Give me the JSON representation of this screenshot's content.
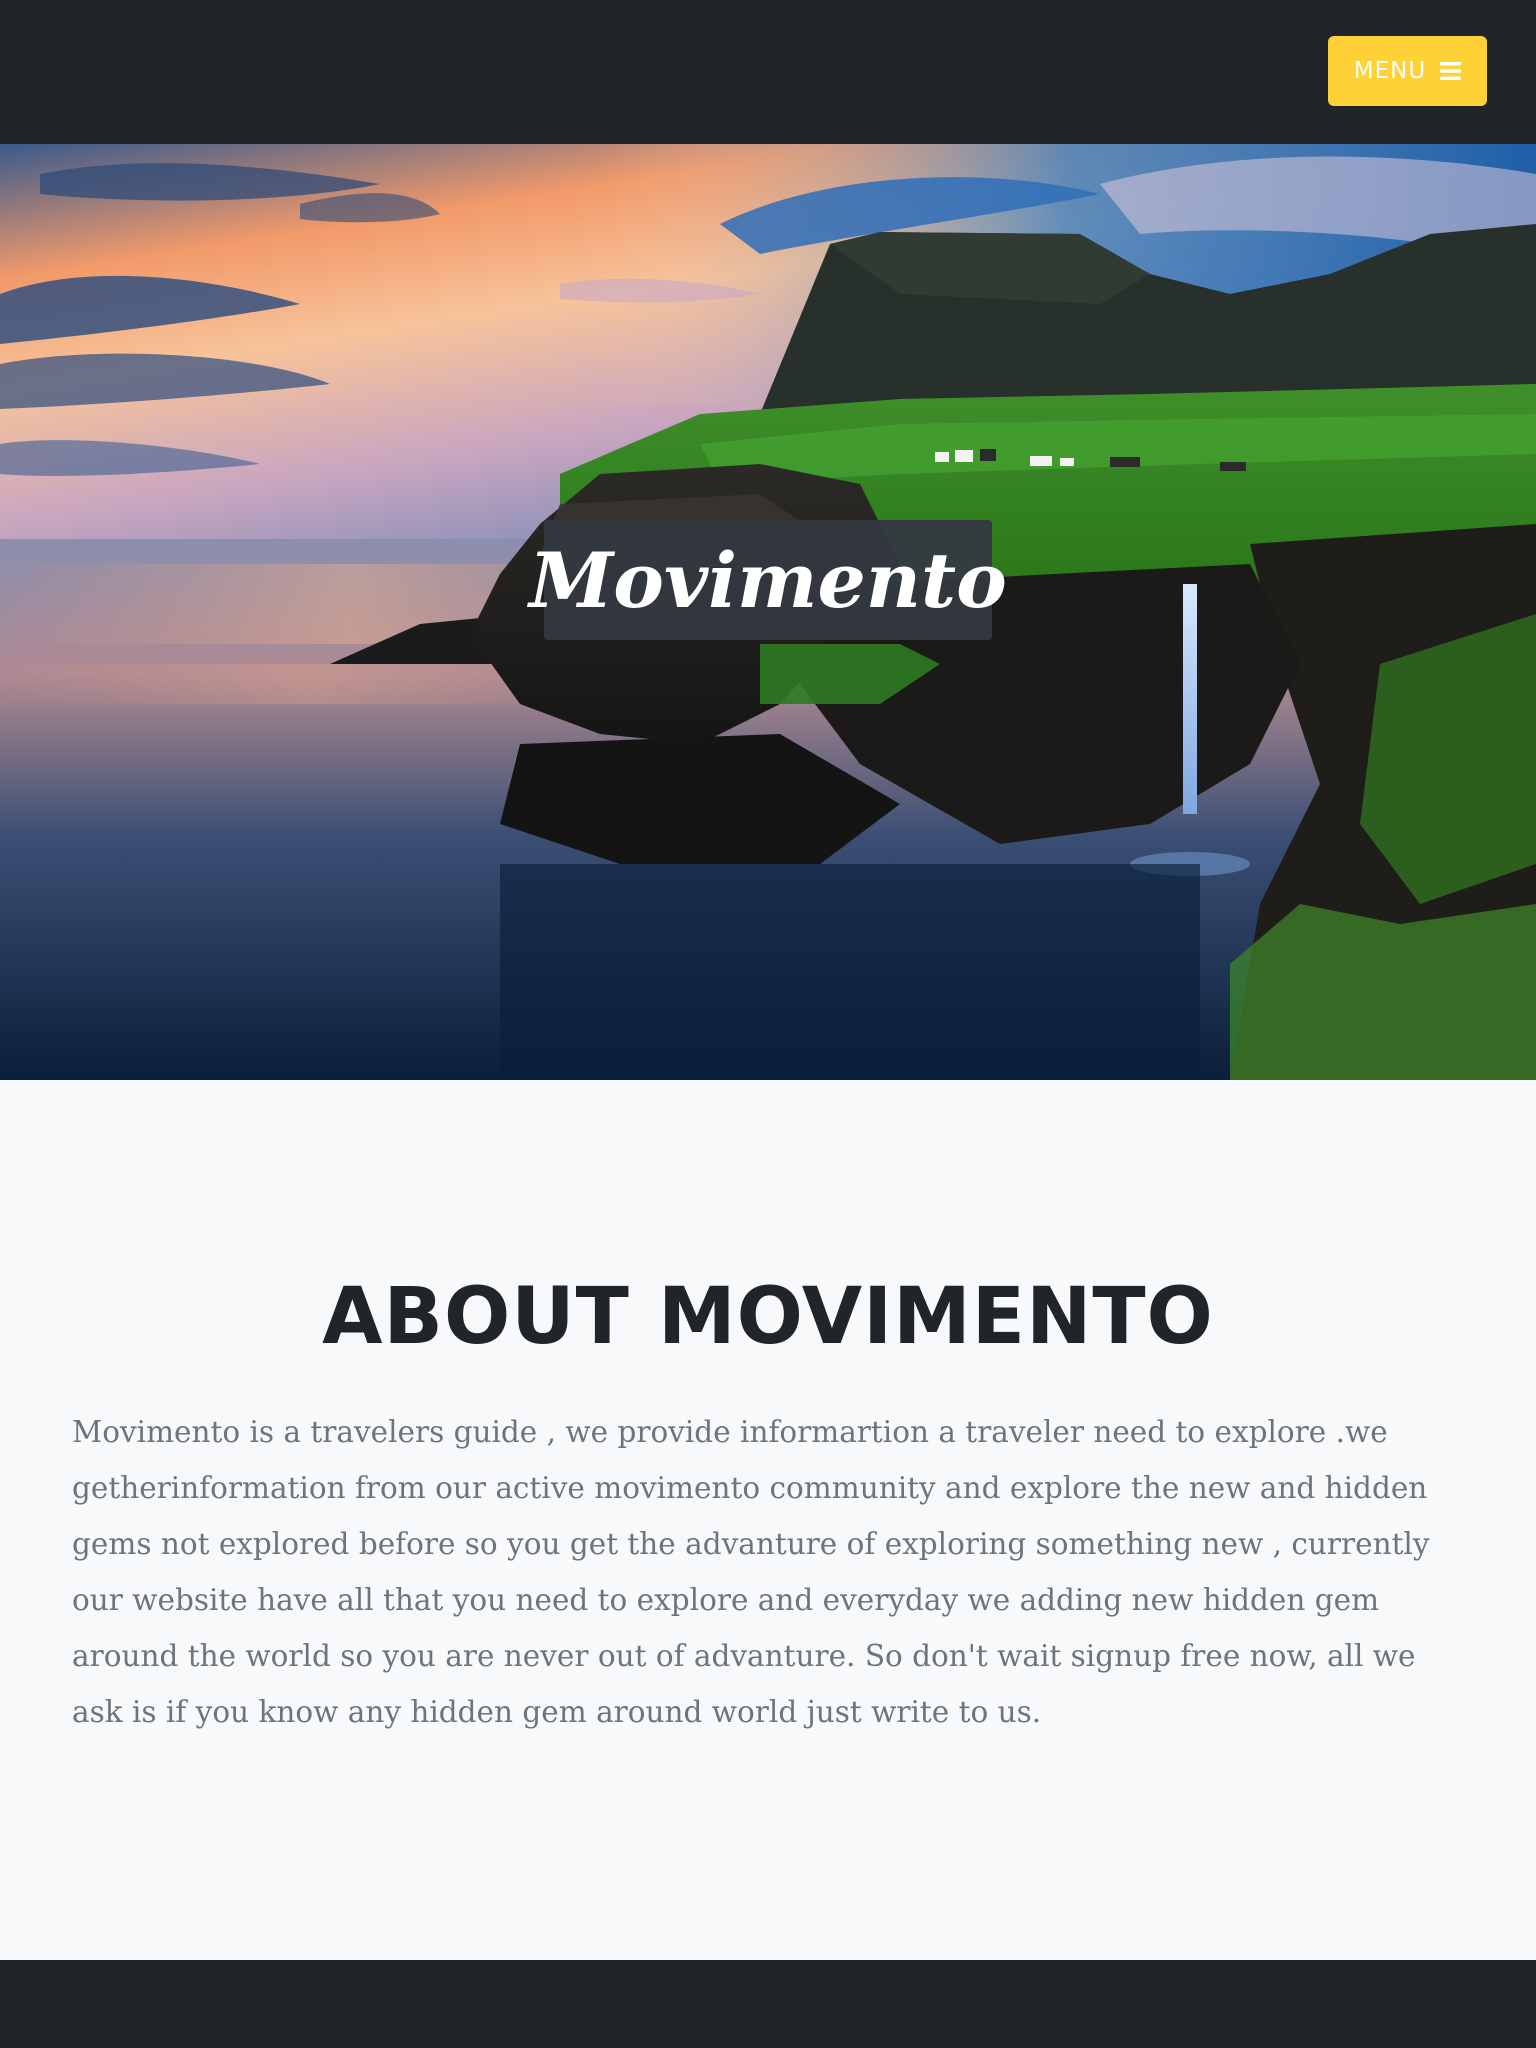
{
  "navbar": {
    "menu_label": "MENU",
    "menu_icon": "bars-icon",
    "background": "#212529",
    "accent": "#fed136"
  },
  "hero": {
    "title": "Movimento",
    "image": "sunset coastal cliff with waterfall and green plateau"
  },
  "about": {
    "heading": "ABOUT MOVIMENTO",
    "text": "Movimento is a travelers guide , we provide informartion a traveler need to explore .we getherinformation from our active movimento community and explore the new and hidden gems not explored before so you get the advanture of exploring something new , currently our website have all that you need to explore and everyday we adding new hidden gem around the world so you are never out of advanture. So don't wait signup free now, all we ask is if you know any hidden gem around world just write to us."
  }
}
